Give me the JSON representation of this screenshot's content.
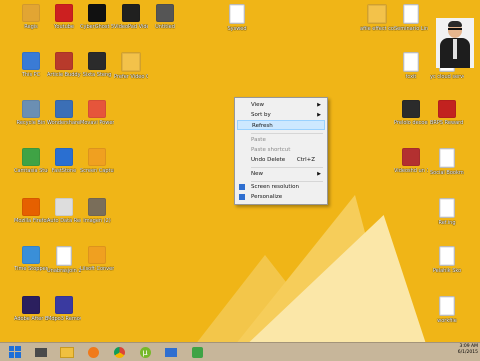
{
  "desktop": {
    "icons": [
      {
        "label": "Regis",
        "color": "#e2a533",
        "glyph": "folder-user-icon"
      },
      {
        "label": "Youtube",
        "color": "#cc2020",
        "glyph": "youtube-icon"
      },
      {
        "label": "CyberGhost 5",
        "color": "#111111",
        "glyph": "cyberghost-icon"
      },
      {
        "label": "VideoPad Video Editor",
        "color": "#20201f",
        "glyph": "videopad-icon"
      },
      {
        "label": "Untitled",
        "color": "#555555",
        "glyph": "video-thumb-icon"
      },
      {
        "label": "Syswed",
        "color": "#ffffff",
        "glyph": "document-icon"
      },
      {
        "label": "afile effect co",
        "color": "#f3c24a",
        "glyph": "folder-icon"
      },
      {
        "label": "Seminario Links",
        "color": "#ffffff",
        "glyph": "document-icon"
      },
      {
        "label": "This PC",
        "color": "#3a7bd5",
        "glyph": "computer-icon"
      },
      {
        "label": "Article Buddy 2 - Shortcut",
        "color": "#b83a2b",
        "glyph": "java-icon"
      },
      {
        "label": "Sixta Steng",
        "color": "#2b2b2b",
        "glyph": "video-thumb-icon"
      },
      {
        "label": "Prefer Video Clips",
        "color": "#f3c24a",
        "glyph": "folder-icon"
      },
      {
        "label": "fcxit",
        "color": "#ffffff",
        "glyph": "document-icon"
      },
      {
        "label": "yc cloud server",
        "color": "#ffffff",
        "glyph": "document-icon"
      },
      {
        "label": "Recycle Bin",
        "color": "#6b8fb3",
        "glyph": "recycle-bin-icon"
      },
      {
        "label": "Wondershare Filmora",
        "color": "#3b6fb6",
        "glyph": "filmora-icon"
      },
      {
        "label": "Movavi Powerline",
        "color": "#e6553b",
        "glyph": "movavi-icon"
      },
      {
        "label": "Prelolo decoes",
        "color": "#2b2b2b",
        "glyph": "video-thumb-icon"
      },
      {
        "label": "BRPS Reward Key",
        "color": "#c2221f",
        "glyph": "image-icon"
      },
      {
        "label": "Camtasia Studio 8",
        "color": "#3fa345",
        "glyph": "camtasia-icon"
      },
      {
        "label": "FastStone",
        "color": "#2a6fd1",
        "glyph": "faststone-icon"
      },
      {
        "label": "Screen Capturing",
        "color": "#f0a020",
        "glyph": "vlc-icon"
      },
      {
        "label": "Videoshd un 1",
        "color": "#b33030",
        "glyph": "video-thumb-icon"
      },
      {
        "label": "Social Bookmarki",
        "color": "#ffffff",
        "glyph": "document-icon"
      },
      {
        "label": "Mozilla Firefox",
        "color": "#e66000",
        "glyph": "firefox-icon"
      },
      {
        "label": "Auto Data Recovery Ho",
        "color": "#dddddd",
        "glyph": "recovery-icon"
      },
      {
        "label": "Imagen (2)",
        "color": "#7a6e5a",
        "glyph": "image-icon"
      },
      {
        "label": "Ref.ing",
        "color": "#ffffff",
        "glyph": "document-icon"
      },
      {
        "label": "Time Stopper",
        "color": "#3a8fd8",
        "glyph": "clock-icon"
      },
      {
        "label": "Unabrasjoin 20",
        "color": "#ffffff",
        "glyph": "document-icon"
      },
      {
        "label": "Lilsoft Converter",
        "color": "#f0a020",
        "glyph": "converter-icon"
      },
      {
        "label": "Pelahik Sko",
        "color": "#ffffff",
        "glyph": "document-icon"
      },
      {
        "label": "Adobe After Effects CC",
        "color": "#2b1f5e",
        "glyph": "after-effects-icon"
      },
      {
        "label": "Mdpo3 Remover",
        "color": "#3a3aa0",
        "glyph": "remover-icon"
      },
      {
        "label": "workfile",
        "color": "#ffffff",
        "glyph": "document-icon"
      }
    ]
  },
  "context_menu": {
    "view": "View",
    "sort_by": "Sort by",
    "refresh": "Refresh",
    "paste": "Paste",
    "paste_shortcut": "Paste shortcut",
    "undo_delete": "Undo Delete",
    "undo_shortcut": "Ctrl+Z",
    "new": "New",
    "screen_resolution": "Screen resolution",
    "personalize": "Personalize"
  },
  "taskbar": {
    "apps": [
      "start-icon",
      "explorer-icon",
      "folder-icon",
      "media-player-icon",
      "chrome-icon",
      "utorrent-icon",
      "desktop-icon",
      "camtasia-icon"
    ],
    "time": "3:09 AM",
    "date": "6/1/2015"
  }
}
